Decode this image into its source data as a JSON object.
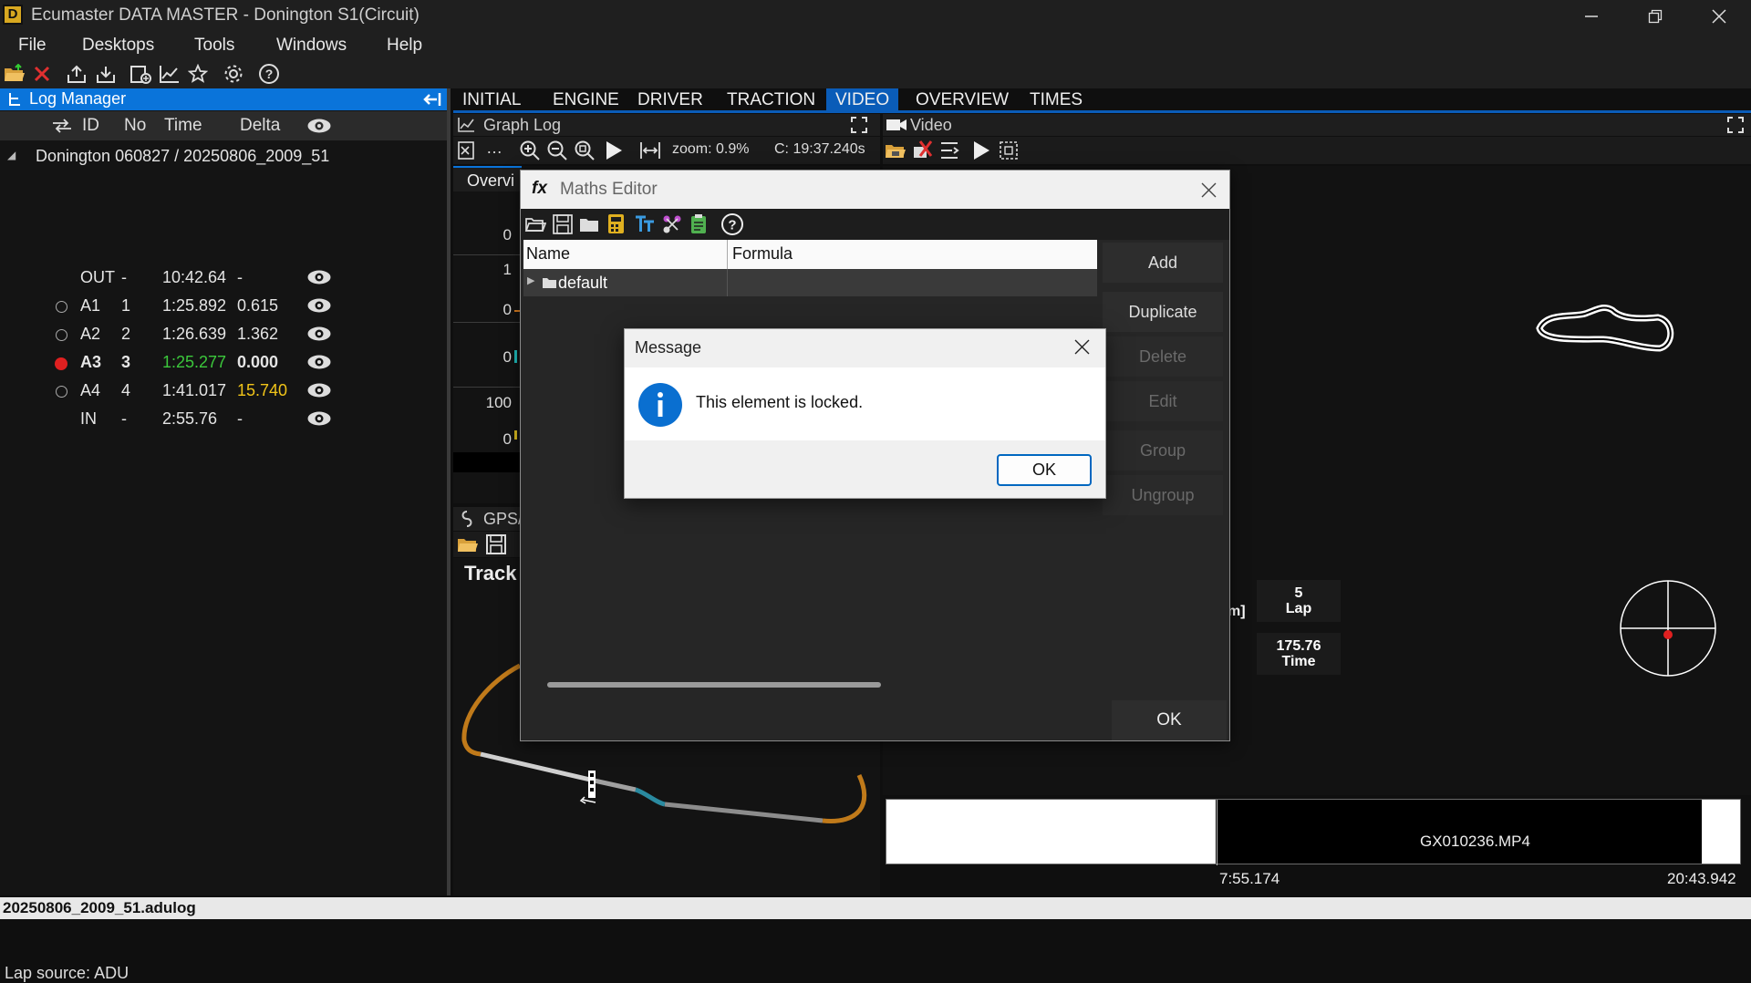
{
  "window": {
    "title": "Ecumaster DATA MASTER - Donington S1(Circuit)"
  },
  "menu": [
    "File",
    "Desktops",
    "Tools",
    "Windows",
    "Help"
  ],
  "log_manager": {
    "title": "Log Manager",
    "columns": {
      "id": "ID",
      "no": "No",
      "time": "Time",
      "delta": "Delta"
    },
    "session": "Donington 060827 / 20250806_2009_51",
    "rows": [
      {
        "id": "OUT",
        "no": "-",
        "time": "10:42.64",
        "delta": "-",
        "marker": "none"
      },
      {
        "id": "A1",
        "no": "1",
        "time": "1:25.892",
        "delta": "0.615",
        "marker": "empty"
      },
      {
        "id": "A2",
        "no": "2",
        "time": "1:26.639",
        "delta": "1.362",
        "marker": "empty"
      },
      {
        "id": "A3",
        "no": "3",
        "time": "1:25.277",
        "delta": "0.000",
        "marker": "selected"
      },
      {
        "id": "A4",
        "no": "4",
        "time": "1:41.017",
        "delta": "15.740",
        "marker": "empty"
      },
      {
        "id": "IN",
        "no": "-",
        "time": "2:55.76",
        "delta": "-",
        "marker": "none"
      }
    ],
    "lap_source": "Lap source: ADU"
  },
  "tabs": [
    {
      "label": "INITIAL",
      "active": false
    },
    {
      "label": "ENGINE",
      "active": false
    },
    {
      "label": "DRIVER",
      "active": false
    },
    {
      "label": "TRACTION",
      "active": false
    },
    {
      "label": "VIDEO",
      "active": true
    },
    {
      "label": "OVERVIEW",
      "active": false
    },
    {
      "label": "TIMES",
      "active": false
    }
  ],
  "graph_log": {
    "title": "Graph Log",
    "zoom": "zoom: 0.9%",
    "cursor": "C: 19:37.240s",
    "subtab": "Overvi",
    "axis_values": [
      "0",
      "1",
      "0",
      "0",
      "100",
      "0"
    ]
  },
  "gps_panel": {
    "title": "GPS/",
    "heading": "Track"
  },
  "video": {
    "title": "Video",
    "info": [
      {
        "value": "5",
        "label": "Lap"
      },
      {
        "value": "175.76",
        "label": "Time"
      }
    ],
    "partial_unit": "m]",
    "file": "GX010236.MP4",
    "time_start": "7:55.174",
    "time_end": "20:43.942"
  },
  "maths_editor": {
    "title": "Maths Editor",
    "columns": {
      "name": "Name",
      "formula": "Formula"
    },
    "tree": [
      {
        "label": "default"
      }
    ],
    "buttons": [
      {
        "label": "Add",
        "enabled": true
      },
      {
        "label": "Duplicate",
        "enabled": true
      },
      {
        "label": "Delete",
        "enabled": false
      },
      {
        "label": "Edit",
        "enabled": false
      },
      {
        "label": "Group",
        "enabled": false
      },
      {
        "label": "Ungroup",
        "enabled": false
      }
    ],
    "ok": "OK"
  },
  "message": {
    "title": "Message",
    "text": "This element is locked.",
    "ok": "OK"
  },
  "status": {
    "file": "20250806_2009_51.adulog"
  },
  "colors": {
    "accent": "#0a74da",
    "best_lap": "#3cc83c",
    "slow_delta": "#f0c419",
    "marker_red": "#e02020"
  }
}
